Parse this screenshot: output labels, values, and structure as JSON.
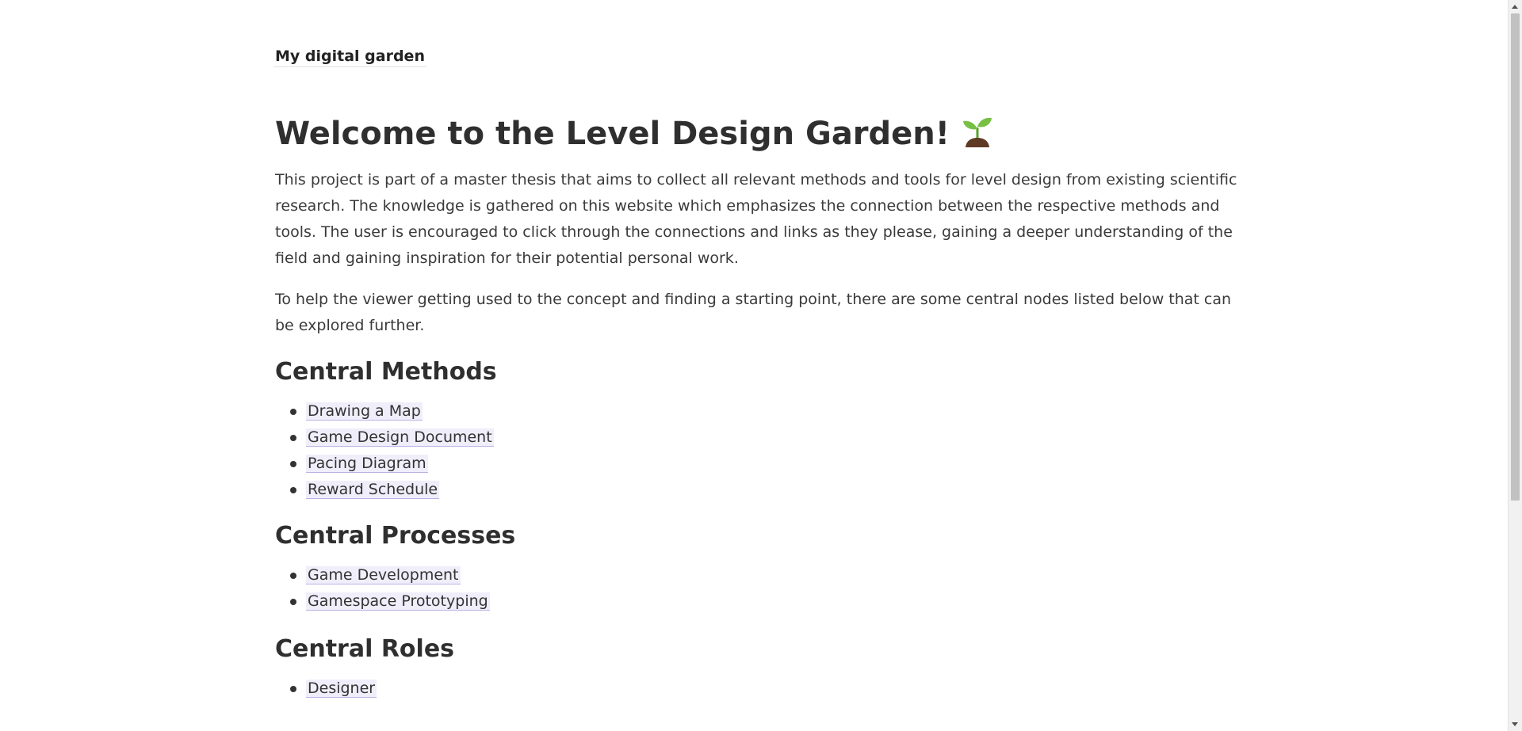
{
  "header": {
    "site_title": "My digital garden"
  },
  "main": {
    "title": "Welcome to the Level Design Garden!",
    "title_icon": "sprout-icon",
    "paragraphs": [
      "This project is part of a master thesis that aims to collect all relevant methods and tools for level design from existing scientific research. The knowledge is gathered on this website which emphasizes the connection between the respective methods and tools. The user is encouraged to click through the connections and links as they please, gaining a deeper understanding of the field and gaining inspiration for their potential personal work.",
      "To help the viewer getting used to the concept and finding a starting point, there are some central nodes listed below that can be explored further."
    ],
    "sections": [
      {
        "heading": "Central Methods",
        "items": [
          "Drawing a Map",
          "Game Design Document",
          "Pacing Diagram",
          "Reward Schedule"
        ]
      },
      {
        "heading": "Central Processes",
        "items": [
          "Game Development",
          "Gamespace Prototyping"
        ]
      },
      {
        "heading": "Central Roles",
        "items": [
          "Designer"
        ]
      }
    ]
  },
  "colors": {
    "link_background": "#f0eefa",
    "link_underline": "#b9b2e3",
    "text": "#333333"
  }
}
